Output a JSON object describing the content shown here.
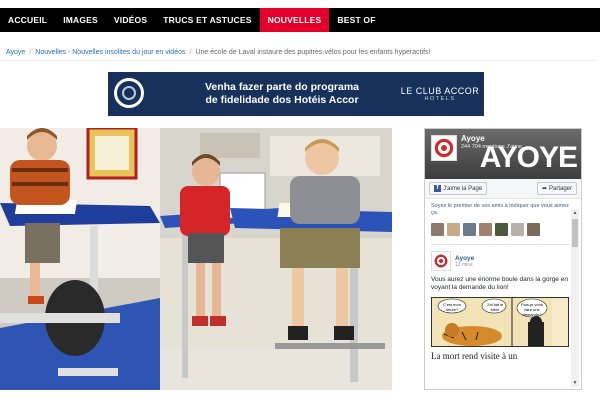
{
  "nav": {
    "items": [
      {
        "label": "ACCUEIL",
        "active": false
      },
      {
        "label": "IMAGES",
        "active": false
      },
      {
        "label": "VIDÉOS",
        "active": false
      },
      {
        "label": "TRUCS ET ASTUCES",
        "active": false
      },
      {
        "label": "NOUVELLES",
        "active": true
      },
      {
        "label": "BEST OF",
        "active": false
      }
    ],
    "active_color": "#e4002b"
  },
  "breadcrumb": {
    "home": "Ayoye",
    "section": "Nouvelles - Nouvelles insolites du jour en vidéos",
    "current": "Une école de Laval instaure des pupitres-vélos pour les enfants hyperactifs!"
  },
  "ad": {
    "line1": "Venha fazer parte do programa",
    "line2": "de fidelidade dos Hotéis Accor",
    "brand": "LE CLUB ACCOR",
    "brand_sub": "HOTELS",
    "background": "#17315a"
  },
  "hero": {
    "description": "children-on-pedal-desks"
  },
  "facebook": {
    "page_name": "Ayoye",
    "likes_text": "244 704 mentions J'aime",
    "cover_text": "AYOYE",
    "like_button": "J'aime la Page",
    "share_button": "Partager",
    "invite_text": "Soyez le premier de vos amis à indiquer que vous aimez ça.",
    "post": {
      "author": "Ayoye",
      "time": "12 mins",
      "text": "Vous aurez une énorme boule dans la gorge en voyant la demande du lion!",
      "bubble1": "C'est mon heure?",
      "bubble2": "J'ai fait le bien!",
      "bubble3": "Puis-je vous faire une demande?",
      "caption": "La mort rend visite à un"
    },
    "brand_color": "#3b5998"
  }
}
